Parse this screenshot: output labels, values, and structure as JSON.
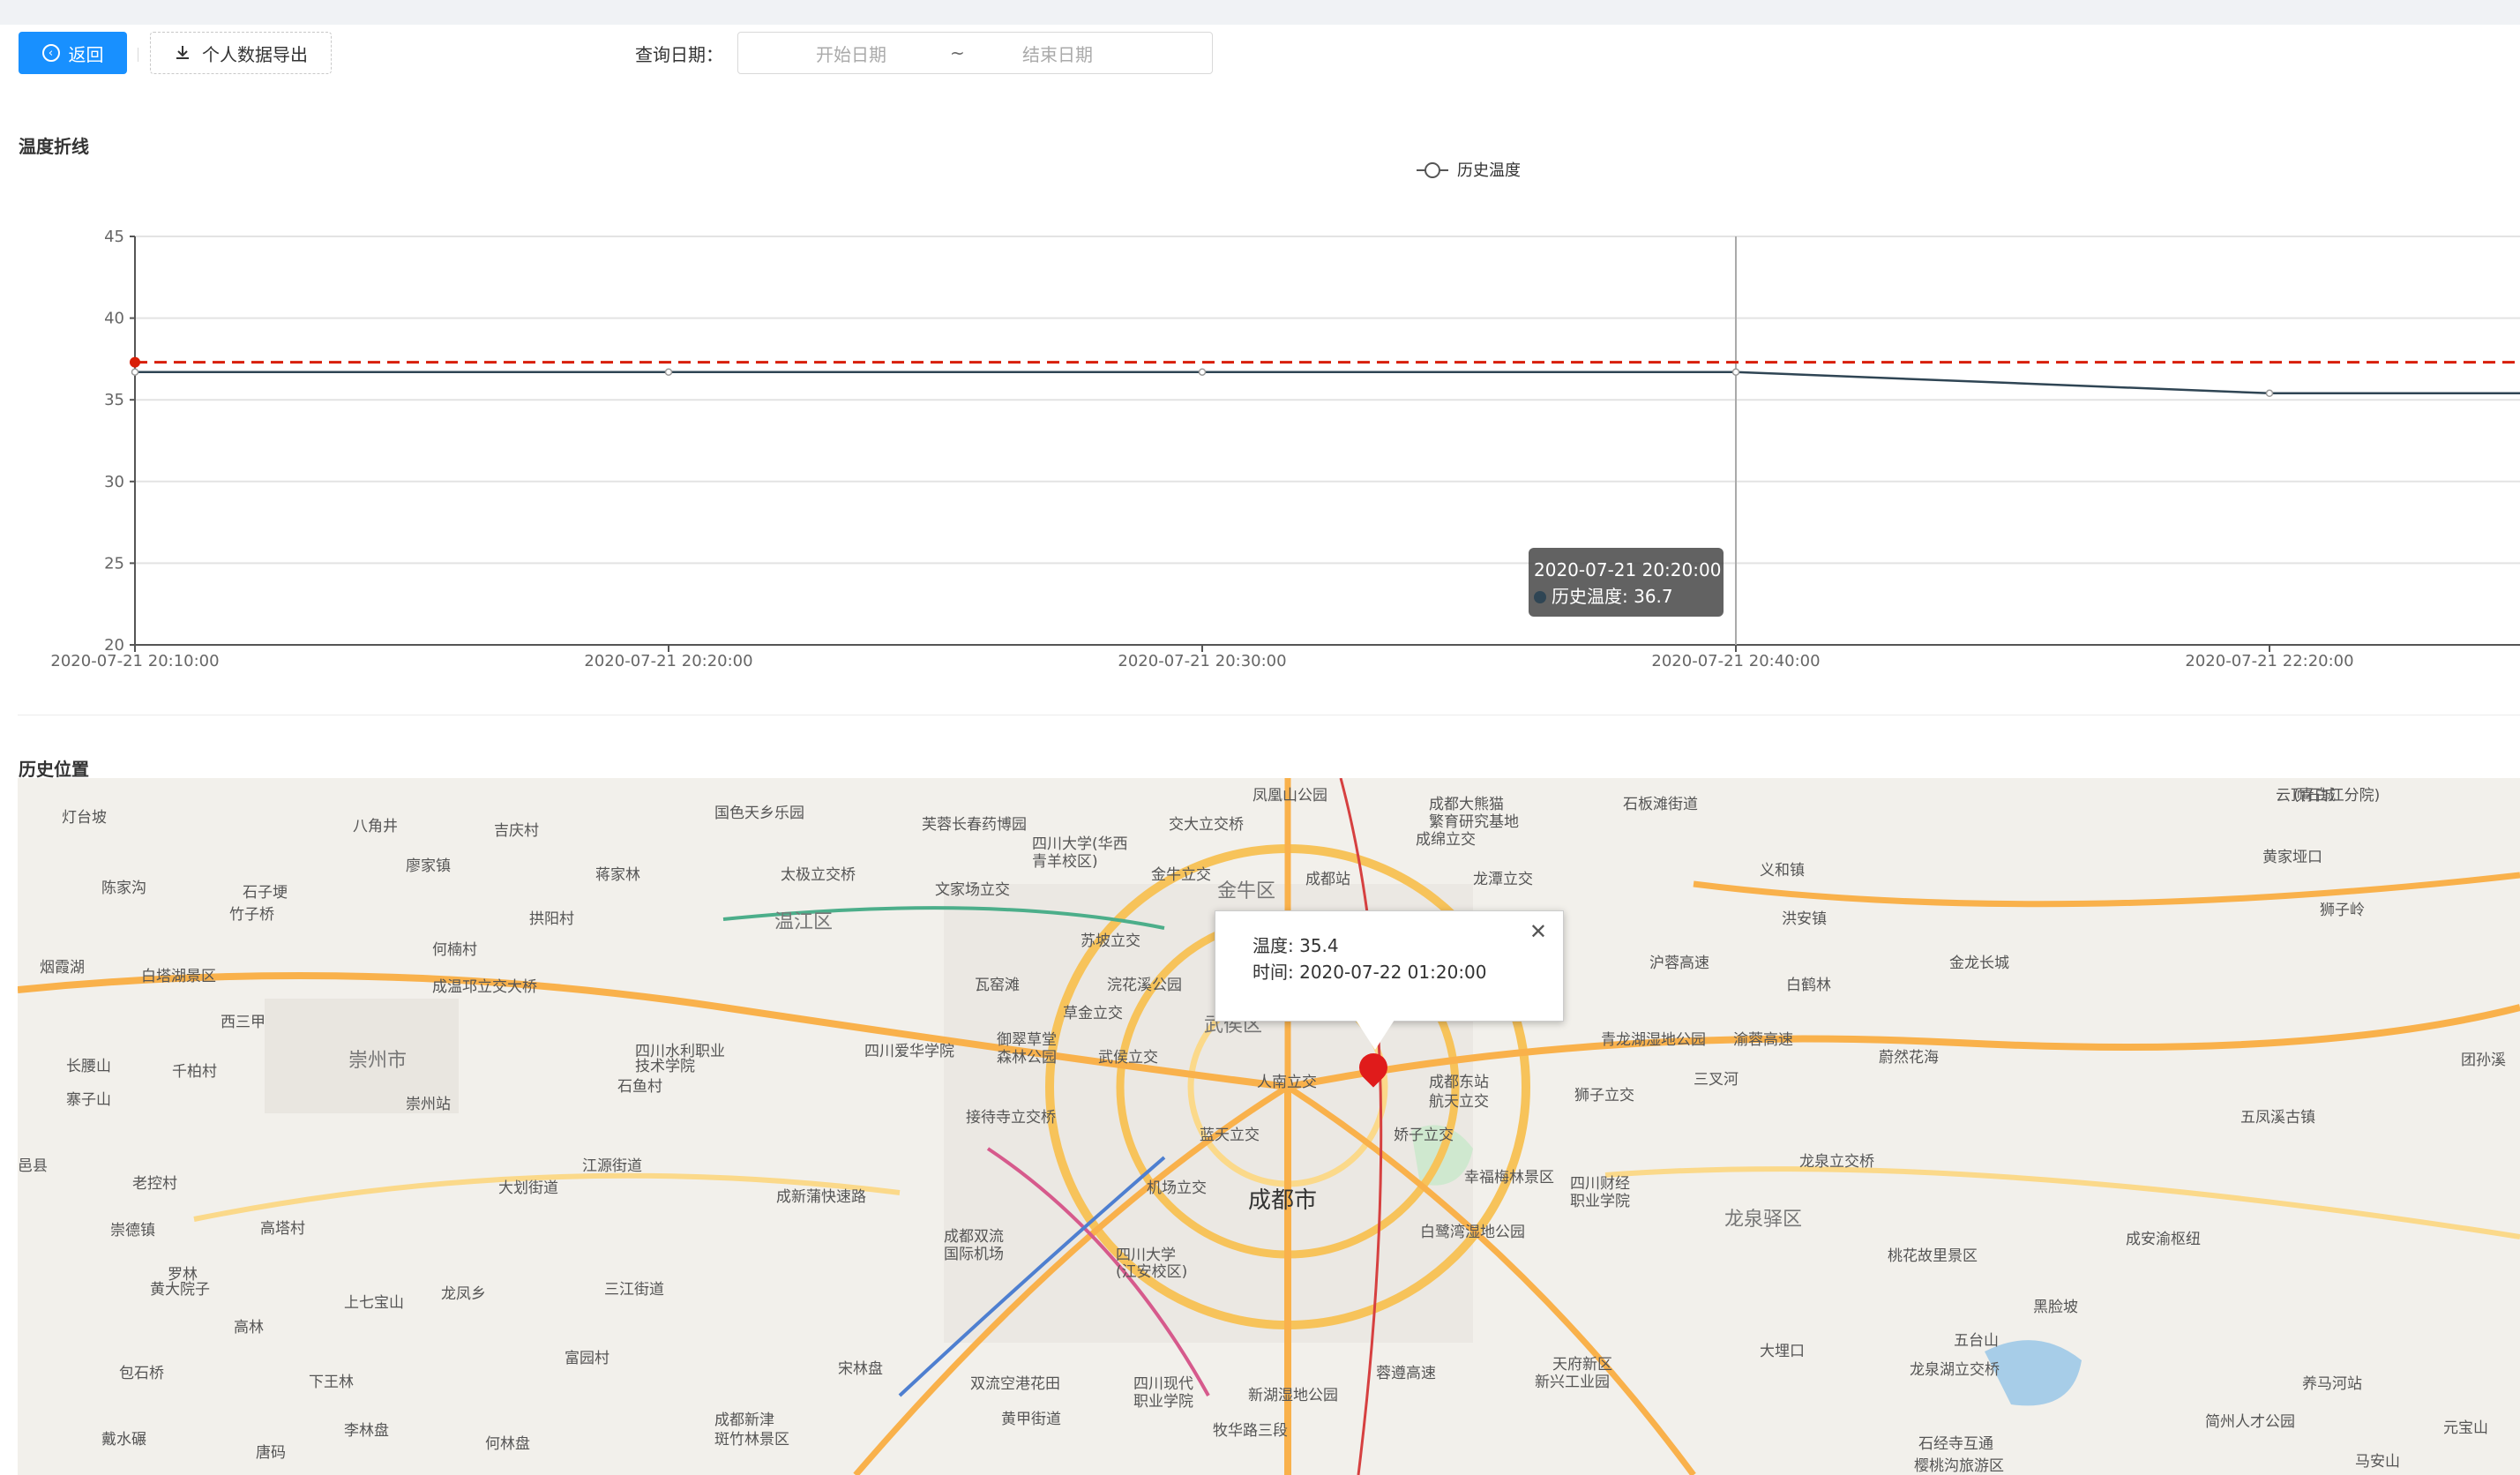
{
  "toolbar": {
    "back_label": "返回",
    "back_icon": "circle-left-icon",
    "export_label": "个人数据导出",
    "export_icon": "download-icon",
    "query_date_label": "查询日期：",
    "start_placeholder": "开始日期",
    "range_separator": "~",
    "end_placeholder": "结束日期"
  },
  "sections": {
    "temperature_title": "温度折线",
    "location_title": "历史位置"
  },
  "chart_data": {
    "type": "line",
    "legend": [
      "历史温度"
    ],
    "categories": [
      "2020-07-21 20:10:00",
      "2020-07-21 20:20:00",
      "2020-07-21 20:30:00",
      "2020-07-21 20:40:00",
      "2020-07-21 22:20:00",
      "2020-07-22 01:20:00"
    ],
    "series": [
      {
        "name": "历史温度",
        "values": [
          36.7,
          36.7,
          36.7,
          36.7,
          35.4,
          35.4
        ],
        "color": "#2f4554"
      }
    ],
    "threshold": {
      "value": 37.3,
      "color": "#d81e06"
    },
    "ylim": [
      20,
      45
    ],
    "yticks": [
      20,
      25,
      30,
      35,
      40,
      45
    ],
    "grid": true,
    "legend_position": "top-center"
  },
  "tooltip": {
    "time": "2020-07-21 20:20:00",
    "series_line": "历史温度: 36.7"
  },
  "map": {
    "labels": [
      "灯台坡",
      "八角井",
      "吉庆村",
      "国色天乡乐园",
      "芙蓉长春药博园",
      "四川大学(华西",
      "青羊校区)",
      "交大立交桥",
      "凤凰山公园",
      "成都大熊猫",
      "繁育研究基地",
      "成绵立交",
      "石板滩街道",
      "(青白江分院)",
      "云顶石城",
      "陈家沟",
      "廖家镇",
      "石子埂",
      "太极立交桥",
      "文家场立交",
      "金牛立交",
      "金牛区",
      "成都站",
      "龙潭立交",
      "义和镇",
      "黄家垭口",
      "烟霞湖",
      "竹子桥",
      "蒋家林",
      "拱阳村",
      "温江区",
      "苏坡立交",
      "沪蓉高速",
      "洪安镇",
      "狮子岭",
      "白塔湖景区",
      "何楠村",
      "成温邛立交大桥",
      "浣花溪公园",
      "瓦窑滩",
      "草金立交",
      "白鹤林",
      "金龙长城",
      "西三甲",
      "四川水利职业",
      "技术学院",
      "四川爱华学院",
      "御翠草堂",
      "森林公园",
      "武侯立交",
      "武侯区",
      "青龙湖湿地公园",
      "渝蓉高速",
      "蔚然花海",
      "长腰山",
      "崇州市",
      "千柏村",
      "石鱼村",
      "人南立交",
      "成都东站",
      "航天立交",
      "狮子立交",
      "三叉河",
      "团孙溪",
      "寨子山",
      "崇州站",
      "接待寺立交桥",
      "蓝天立交",
      "娇子立交",
      "龙泉立交桥",
      "五凤溪古镇",
      "邑县",
      "老控村",
      "江源街道",
      "机场立交",
      "幸福梅林景区",
      "四川财经",
      "职业学院",
      "成都市",
      "龙泉驿区",
      "崇德镇",
      "大划街道",
      "高塔村",
      "成都双流",
      "国际机场",
      "四川大学",
      "(江安校区)",
      "白鹭湾湿地公园",
      "桃花故里景区",
      "成安渝枢纽",
      "罗林",
      "黄大院子",
      "三江街道",
      "上七宝山",
      "龙凤乡",
      "成新蒲快速路",
      "天府新区",
      "新兴工业园",
      "大埋口",
      "黑脸坡",
      "高林",
      "包石桥",
      "下王林",
      "富园村",
      "双流空港花田",
      "四川现代",
      "职业学院",
      "新湖湿地公园",
      "蓉遵高速",
      "龙泉湖立交桥",
      "五台山",
      "养马河站",
      "戴水碾",
      "唐码",
      "李林盘",
      "何林盘",
      "成都新津",
      "斑竹林景区",
      "宋林盘",
      "黄甲街道",
      "牧华路三段",
      "石经寺互通",
      "樱桃沟旅游区",
      "简州人才公园",
      "元宝山",
      "马安山"
    ],
    "popup": {
      "temperature": "温度: 35.4",
      "time": "时间: 2020-07-22 01:20:00",
      "close_icon": "close-icon"
    },
    "marker_icon": "map-pin-icon"
  }
}
